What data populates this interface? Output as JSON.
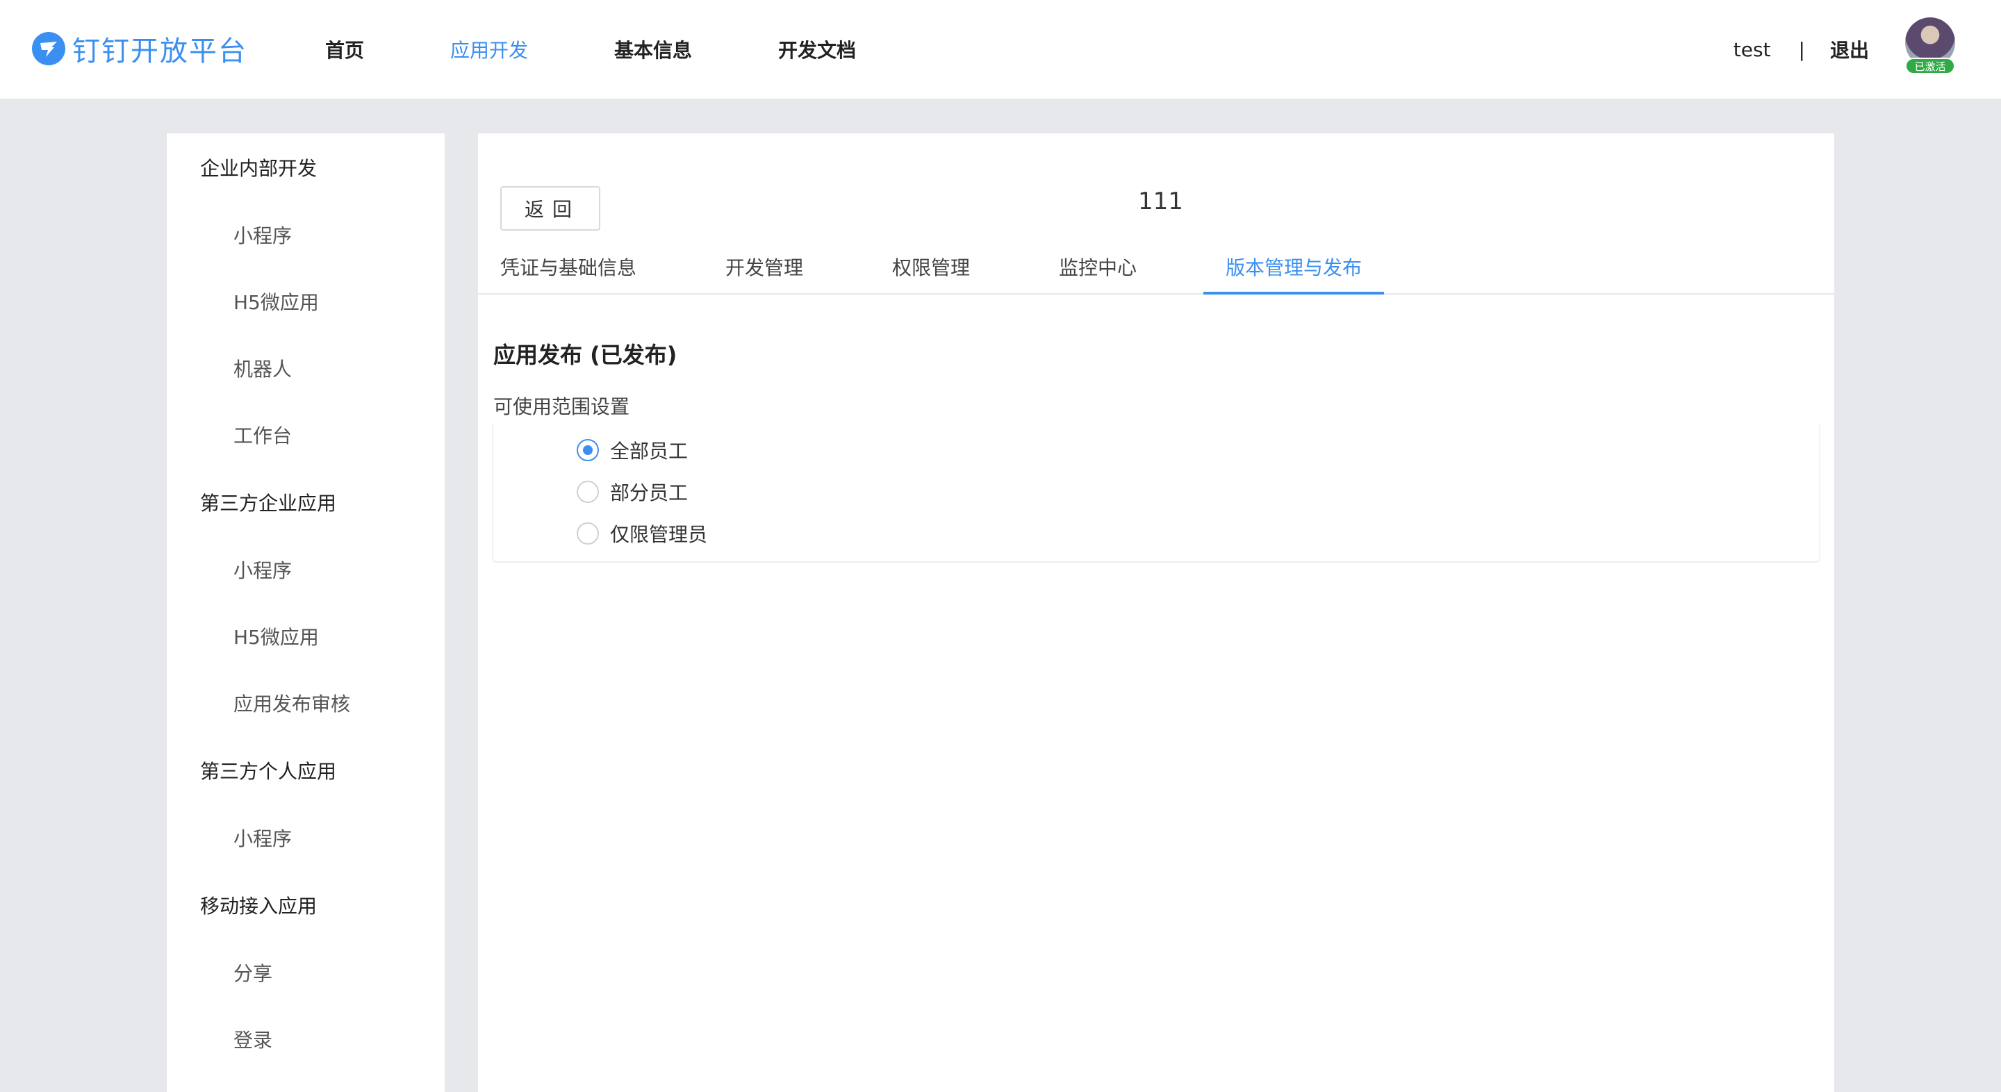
{
  "header": {
    "logo_text": "钉钉开放平台",
    "nav": [
      {
        "label": "首页",
        "active": false
      },
      {
        "label": "应用开发",
        "active": true
      },
      {
        "label": "基本信息",
        "active": false
      },
      {
        "label": "开发文档",
        "active": false
      }
    ],
    "username": "test",
    "separator": "|",
    "logout_label": "退出",
    "avatar_badge": "已激活"
  },
  "sidebar": {
    "groups": [
      {
        "label": "企业内部开发",
        "items": [
          "小程序",
          "H5微应用",
          "机器人",
          "工作台"
        ]
      },
      {
        "label": "第三方企业应用",
        "items": [
          "小程序",
          "H5微应用",
          "应用发布审核"
        ]
      },
      {
        "label": "第三方个人应用",
        "items": [
          "小程序"
        ]
      },
      {
        "label": "移动接入应用",
        "items": [
          "分享",
          "登录"
        ]
      }
    ]
  },
  "main": {
    "back_label": "返回",
    "app_name": "111",
    "tabs": [
      {
        "label": "凭证与基础信息",
        "active": false
      },
      {
        "label": "开发管理",
        "active": false
      },
      {
        "label": "权限管理",
        "active": false
      },
      {
        "label": "监控中心",
        "active": false
      },
      {
        "label": "版本管理与发布",
        "active": true
      }
    ],
    "section_title": "应用发布 (已发布)",
    "scope_label": "可使用范围设置",
    "scope_options": [
      {
        "label": "全部员工",
        "checked": true
      },
      {
        "label": "部分员工",
        "checked": false
      },
      {
        "label": "仅限管理员",
        "checked": false
      }
    ]
  },
  "colors": {
    "accent": "#3b8ff0",
    "badge": "#2faa45",
    "page_bg": "#e7e8ec"
  }
}
